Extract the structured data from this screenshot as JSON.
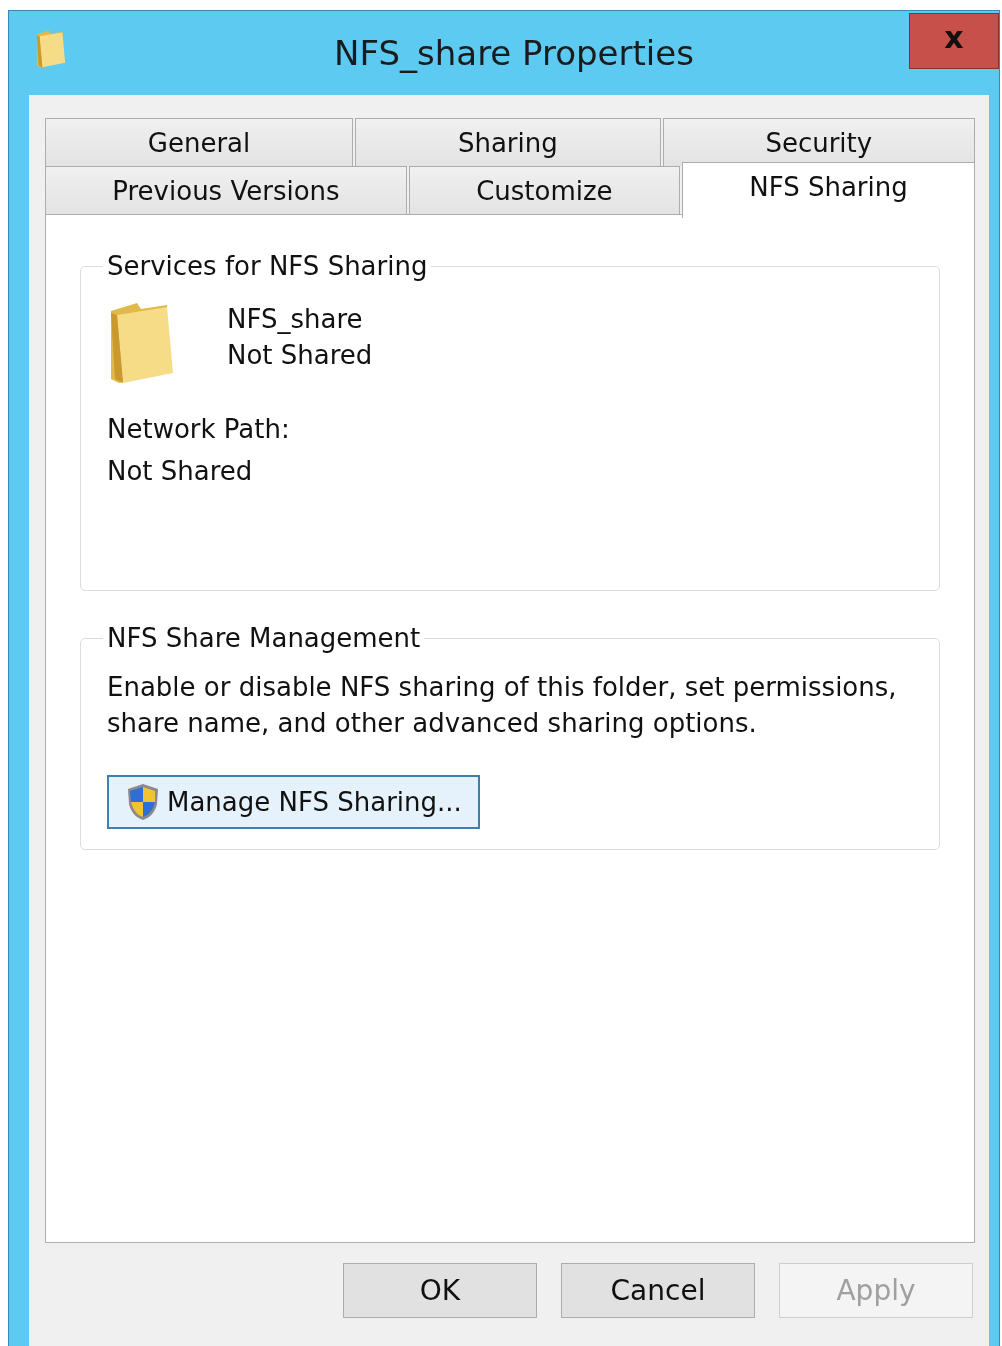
{
  "window": {
    "title": "NFS_share Properties",
    "close": "x"
  },
  "tab_rows": [
    [
      {
        "label": "General",
        "selected": false
      },
      {
        "label": "Sharing",
        "selected": false
      },
      {
        "label": "Security",
        "selected": false
      }
    ],
    [
      {
        "label": "Previous Versions",
        "selected": false
      },
      {
        "label": "Customize",
        "selected": false
      },
      {
        "label": "NFS Sharing",
        "selected": true
      }
    ]
  ],
  "services_group": {
    "legend": "Services for NFS Sharing",
    "folder_name": "NFS_share",
    "share_status": "Not Shared",
    "network_path_label": "Network Path:",
    "network_path": "Not Shared"
  },
  "management_group": {
    "legend": "NFS Share Management",
    "description": "Enable or disable NFS sharing of this folder, set permissions, share name, and other advanced sharing options.",
    "button": "Manage NFS Sharing..."
  },
  "buttons": [
    {
      "label": "OK",
      "disabled": false
    },
    {
      "label": "Cancel",
      "disabled": false
    },
    {
      "label": "Apply",
      "disabled": true
    }
  ]
}
